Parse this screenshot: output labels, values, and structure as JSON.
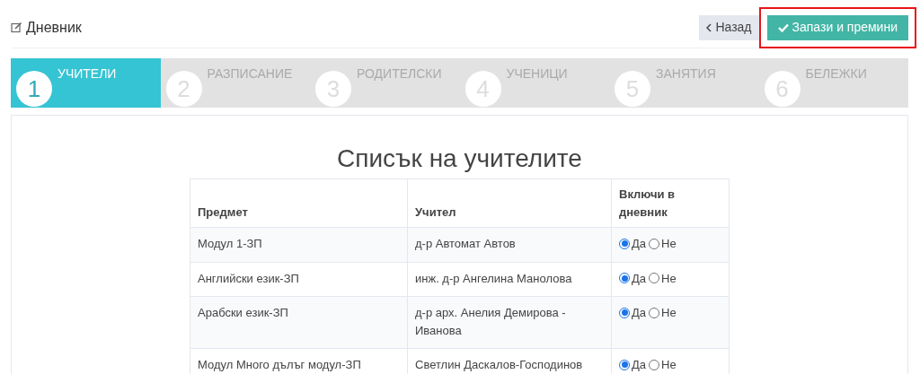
{
  "page_title": "Дневник",
  "buttons": [
    {
      "kind": "back",
      "label": "Назад",
      "highlighted": false
    },
    {
      "kind": "save",
      "label": "Запази и премини",
      "highlighted": true
    }
  ],
  "steps": [
    {
      "number": "1",
      "label": "УЧИТЕЛИ",
      "selected": true
    },
    {
      "number": "2",
      "label": "РАЗПИСАНИЕ",
      "selected": false
    },
    {
      "number": "3",
      "label": "РОДИТЕЛСКИ",
      "selected": false
    },
    {
      "number": "4",
      "label": "УЧЕНИЦИ",
      "selected": false
    },
    {
      "number": "5",
      "label": "ЗАНЯТИЯ",
      "selected": false
    },
    {
      "number": "6",
      "label": "БЕЛЕЖКИ",
      "selected": false
    }
  ],
  "list_title": "Списък на учителите",
  "table": {
    "columns": [
      "Предмет",
      "Учител",
      "Включи в дневник"
    ],
    "rows": [
      {
        "subject": "Модул 1-ЗП",
        "teacher": "д-р Автомат Автов",
        "options": [
          {
            "label": "Да",
            "selected": true
          },
          {
            "label": "Не",
            "selected": false
          }
        ]
      },
      {
        "subject": "Английски език-ЗП",
        "teacher": "инж. д-р Ангелина Манолова",
        "options": [
          {
            "label": "Да",
            "selected": true
          },
          {
            "label": "Не",
            "selected": false
          }
        ]
      },
      {
        "subject": "Арабски език-ЗП",
        "teacher": "д-р арх. Анелия Демирова - Иванова",
        "options": [
          {
            "label": "Да",
            "selected": true
          },
          {
            "label": "Не",
            "selected": false
          }
        ]
      },
      {
        "subject": "Модул Много дълъг модул-ЗП",
        "teacher": "Светлин Даскалов-Господинов",
        "options": [
          {
            "label": "Да",
            "selected": true
          },
          {
            "label": "Не",
            "selected": false
          }
        ]
      }
    ]
  }
}
